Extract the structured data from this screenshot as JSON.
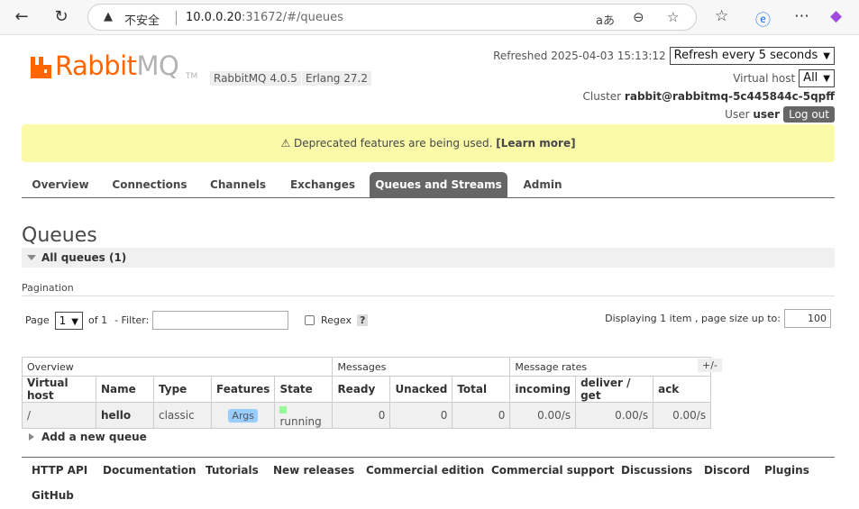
{
  "browser": {
    "warning_label": "不安全",
    "url_host": "10.0.0.20",
    "url_rest": ":31672/#/queues"
  },
  "header": {
    "logo_rabbit": "Rabbit",
    "logo_mq": "MQ",
    "logo_tm": "TM",
    "rabbitmq_version": "RabbitMQ 4.0.5",
    "erlang_version": "Erlang 27.2",
    "refreshed": "Refreshed 2025-04-03 15:13:12",
    "refresh_select": "Refresh every 5 seconds",
    "vhost_label": "Virtual host",
    "vhost_select": "All",
    "cluster_label": "Cluster",
    "cluster_name": "rabbit@rabbitmq-5c445844c-5qpff",
    "user_label": "User",
    "user_name": "user",
    "logout": "Log out"
  },
  "banner": {
    "text": "⚠ Deprecated features are being used.",
    "link": "[Learn more]"
  },
  "tabs": [
    {
      "label": "Overview"
    },
    {
      "label": "Connections"
    },
    {
      "label": "Channels"
    },
    {
      "label": "Exchanges"
    },
    {
      "label": "Queues and Streams"
    },
    {
      "label": "Admin"
    }
  ],
  "page": {
    "title": "Queues",
    "section": "All queues (1)",
    "pagination_label": "Pagination",
    "page_label": "Page",
    "page_value": "1",
    "of_label": "of 1",
    "filter_label": "- Filter:",
    "regex_label": "Regex",
    "help": "?",
    "displaying": "Displaying 1 item , page size up to:",
    "page_size": "100"
  },
  "table": {
    "groups": [
      "Overview",
      "Messages",
      "Message rates"
    ],
    "plusminus": "+/-",
    "headers": [
      "Virtual host",
      "Name",
      "Type",
      "Features",
      "State",
      "Ready",
      "Unacked",
      "Total",
      "incoming",
      "deliver / get",
      "ack"
    ],
    "row": {
      "vhost": "/",
      "name": "hello",
      "type": "classic",
      "features": "Args",
      "state": "running",
      "ready": "0",
      "unacked": "0",
      "total": "0",
      "incoming": "0.00/s",
      "deliver_get": "0.00/s",
      "ack": "0.00/s"
    }
  },
  "add_queue": "Add a new queue",
  "footer": [
    "HTTP API",
    "Documentation",
    "Tutorials",
    "New releases",
    "Commercial edition",
    "Commercial support",
    "Discussions",
    "Discord",
    "Plugins",
    "GitHub"
  ],
  "colors": {
    "brand": "#ff6600",
    "banner": "#fafaa0",
    "active_tab": "#666666",
    "running": "#98f898"
  }
}
